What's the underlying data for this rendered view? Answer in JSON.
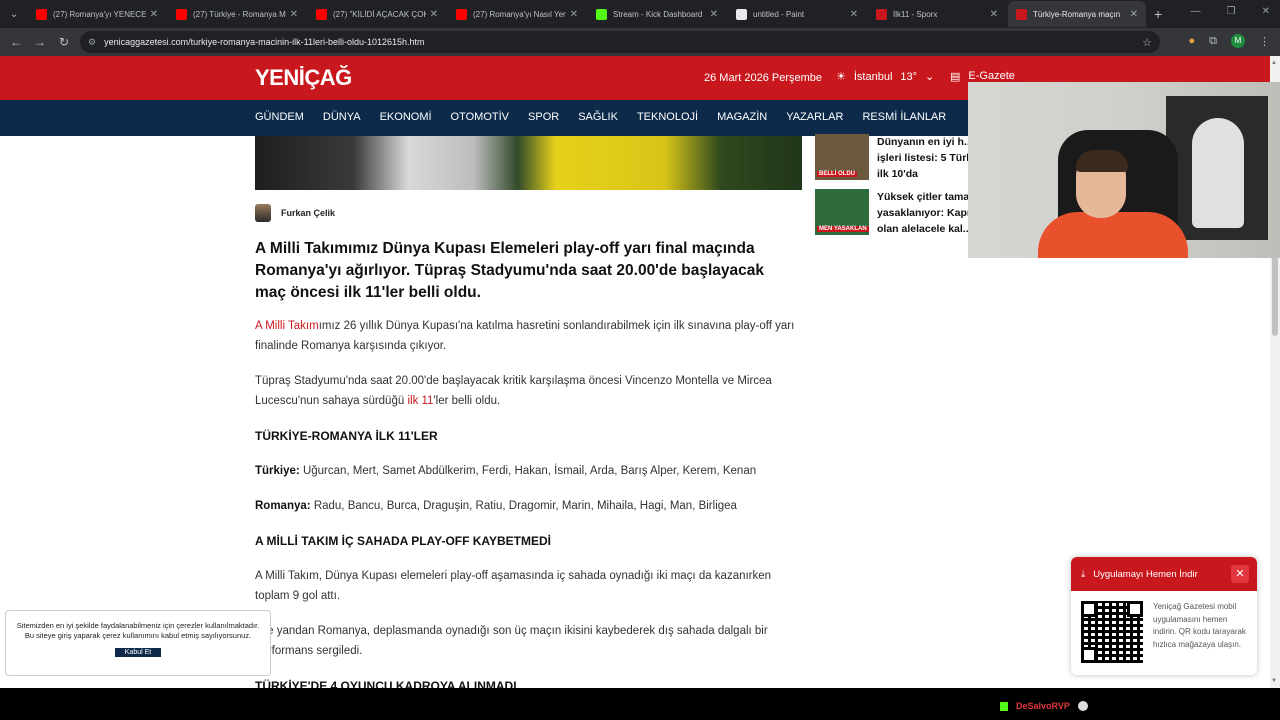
{
  "browser": {
    "tabs": [
      {
        "title": "(27) Romanya'yı YENECE",
        "color": "#ff0000",
        "active": false
      },
      {
        "title": "(27) Türkiye - Romanya M",
        "color": "#ff0000",
        "active": false
      },
      {
        "title": "(27) \"KİLİDİ AÇACAK ÇOK",
        "color": "#ff0000",
        "active": false
      },
      {
        "title": "(27) Romanya'yı Nasıl Yen",
        "color": "#ff0000",
        "active": false
      },
      {
        "title": "Stream - Kick Dashboard",
        "color": "#53fc18",
        "active": false
      },
      {
        "title": "untitled - Paint",
        "color": "#e8eaed",
        "active": false
      },
      {
        "title": "İlk11 - Sporx",
        "color": "#c8181e",
        "active": false
      },
      {
        "title": "Türkiye-Romanya maçın",
        "color": "#c8181e",
        "active": true
      }
    ],
    "url": "yenicaggazetesi.com/turkiye-romanya-macinin-ilk-11leri-belli-oldu-1012615h.htm",
    "profile_initial": "M"
  },
  "site": {
    "logo": "YENİÇAĞ",
    "date": "26 Mart 2026 Perşembe",
    "weather_city": "İstanbul",
    "weather_temp": "13°",
    "egazete": "E-Gazete",
    "menu": [
      "GÜNDEM",
      "DÜNYA",
      "EKONOMİ",
      "OTOMOTİV",
      "SPOR",
      "SAĞLIK",
      "TEKNOLOJİ",
      "MAGAZİN",
      "YAZARLAR",
      "RESMİ İLANLAR"
    ]
  },
  "article": {
    "author": "Furkan Çelik",
    "lead": "A Milli Takımımız Dünya Kupası Elemeleri play-off yarı final maçında Romanya'yı ağırlıyor. Tüpraş Stadyumu'nda saat 20.00'de başlayacak maç öncesi ilk 11'ler belli oldu.",
    "p1_link": "A Milli Takım",
    "p1_rest": "ımız 26 yıllık Dünya Kupası'na katılma hasretini sonlandırabilmek için ilk sınavına play-off yarı finalinde Romanya karşısında çıkıyor.",
    "p2_before": "Tüpraş Stadyumu'nda saat 20.00'de başlayacak kritik karşılaşma öncesi Vincenzo Montella ve Mircea Lucescu'nun sahaya sürdüğü ",
    "p2_link": "ilk 11",
    "p2_after": "'ler belli oldu.",
    "h_lineups": "TÜRKİYE-ROMANYA İLK 11'LER",
    "tr_label": "Türkiye:",
    "tr_players": "Uğurcan, Mert, Samet Abdülkerim, Ferdi, Hakan, İsmail, Arda, Barış Alper, Kerem, Kenan",
    "ro_label": "Romanya:",
    "ro_players": "Radu, Bancu, Burca, Draguşin, Ratiu, Dragomir, Marin, Mihaila, Hagi, Man, Birligea",
    "h_playoff": "A MİLLİ TAKIM İÇ SAHADA PLAY-OFF KAYBETMEDİ",
    "p3": "A Milli Takım, Dünya Kupası elemeleri play-off aşamasında iç sahada oynadığı iki maçı da kazanırken toplam 9 gol attı.",
    "p4": "Öte yandan Romanya, deplasmanda oynadığı son üç maçın ikisini kaybederek dış sahada dalgalı bir performans sergiledi.",
    "h_next": "TÜRKİYE'DE 4 OYUNCU KADROYA ALINMADI"
  },
  "sidebar": {
    "items": [
      {
        "title": "Dünyanın en iyi h... işleri listesi: 5 Türk... ilk 10'da",
        "badge": "BELLİ OLDU"
      },
      {
        "title": "Yüksek çitler tama... yasaklanıyor: Kapı... olan alelacele kal...",
        "badge": "MEN YASAKLAN"
      }
    ]
  },
  "cookie": {
    "text": "Sitemizden en iyi şekilde faydalanabilmeniz için çerezler kullanılmaktadır. Bu siteye giriş yaparak çerez kullanımını kabul etmiş sayılıyorsunuz.",
    "button": "Kabul Et"
  },
  "app_promo": {
    "title": "Uygulamayı Hemen İndir",
    "text": "Yeniçağ Gazetesi mobil uygulamasını hemen indirin. QR kodu tarayarak hızlıca mağazaya ulaşın."
  },
  "taskbar": {
    "kick_user": "DeSalvoRVP"
  }
}
